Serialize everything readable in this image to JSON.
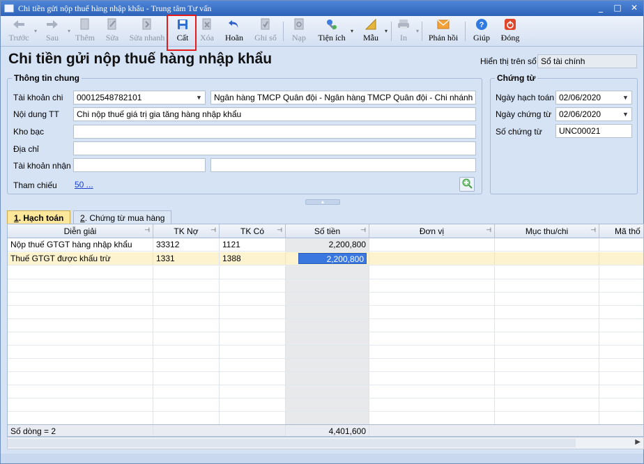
{
  "window": {
    "title": "Chi tiền gửi nộp thuế hàng nhập khẩu - Trung tâm Tư vấn"
  },
  "toolbar": {
    "prev": "Trước",
    "next": "Sau",
    "add": "Thêm",
    "edit": "Sửa",
    "quick_edit": "Sửa nhanh",
    "save": "Cất",
    "delete": "Xóa",
    "undo": "Hoãn",
    "post": "Ghi sổ",
    "reload": "Nạp",
    "utilities": "Tiện ích",
    "template": "Mẫu",
    "print": "In",
    "feedback": "Phản hồi",
    "help": "Giúp",
    "close": "Đóng"
  },
  "page": {
    "title": "Chi tiền gửi nộp thuế hàng nhập khẩu",
    "display_label": "Hiển thị trên sổ",
    "display_value": "Sổ tài chính"
  },
  "general": {
    "section_title": "Thông tin chung",
    "account_label": "Tài khoản chi",
    "account_value": "00012548782101",
    "bank_name": "Ngân hàng TMCP Quân đội  - Ngân hàng TMCP Quân đội - Chi nhánh Th",
    "content_label": "Nội dung TT",
    "content_value": "Chi nộp thuế giá trị gia tăng hàng nhập khẩu",
    "treasury_label": "Kho bạc",
    "treasury_value": "",
    "address_label": "Địa chỉ",
    "address_value": "",
    "receive_account_label": "Tài khoản nhận",
    "receive_account_value": "",
    "receive_bank_value": "",
    "reference_label": "Tham chiếu",
    "reference_link": "50 ..."
  },
  "voucher": {
    "section_title": "Chứng từ",
    "posting_date_label": "Ngày hạch toán",
    "posting_date": "02/06/2020",
    "voucher_date_label": "Ngày chứng từ",
    "voucher_date": "02/06/2020",
    "voucher_no_label": "Số chứng từ",
    "voucher_no": "UNC00021"
  },
  "tabs": [
    {
      "key": "1",
      "label": ". Hạch toán"
    },
    {
      "key": "2",
      "label": ". Chứng từ mua hàng"
    }
  ],
  "grid": {
    "columns": [
      "Diễn giải",
      "TK Nợ",
      "TK Có",
      "Số tiền",
      "Đơn vị",
      "Mục thu/chi",
      "Mã thố"
    ],
    "rows": [
      {
        "description": "Nộp thuế GTGT hàng nhập khẩu",
        "debit": "33312",
        "credit": "1121",
        "amount": "2,200,800"
      },
      {
        "description": "Thuế GTGT được khấu trừ",
        "debit": "1331",
        "credit": "1388",
        "amount": "2,200,800"
      }
    ],
    "footer_count": "Số dòng = 2",
    "footer_total": "4,401,600"
  },
  "colors": {
    "highlight": "#e51b1b",
    "selected_row": "#fdf3cf",
    "active_tab": "#fde79a"
  }
}
